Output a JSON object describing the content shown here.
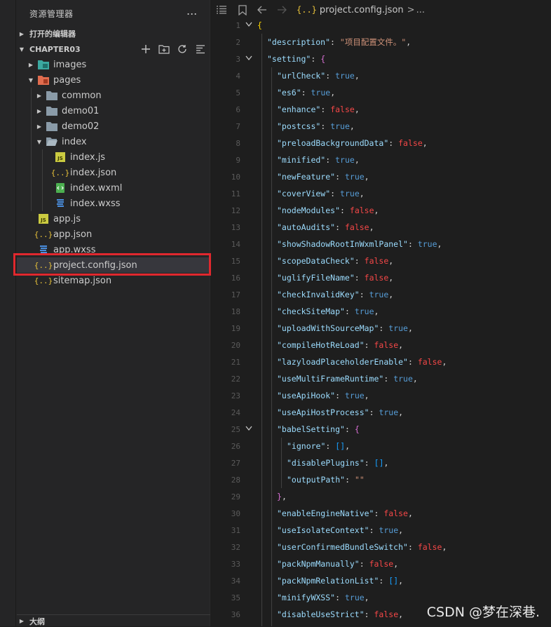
{
  "explorer": {
    "title": "资源管理器",
    "more": "...",
    "open_editors": "打开的编辑器",
    "project": "CHAPTER03",
    "outline": "大纲"
  },
  "tree": [
    {
      "label": "images",
      "depth": 1,
      "type": "folder",
      "expanded": false,
      "icon": "images-folder-icon"
    },
    {
      "label": "pages",
      "depth": 1,
      "type": "folder",
      "expanded": true,
      "icon": "pages-folder-icon"
    },
    {
      "label": "common",
      "depth": 2,
      "type": "folder",
      "expanded": false,
      "icon": "folder-icon"
    },
    {
      "label": "demo01",
      "depth": 2,
      "type": "folder",
      "expanded": false,
      "icon": "folder-icon"
    },
    {
      "label": "demo02",
      "depth": 2,
      "type": "folder",
      "expanded": false,
      "icon": "folder-icon"
    },
    {
      "label": "index",
      "depth": 2,
      "type": "folder",
      "expanded": true,
      "icon": "folder-open-icon"
    },
    {
      "label": "index.js",
      "depth": 3,
      "type": "js",
      "icon": "js-file-icon"
    },
    {
      "label": "index.json",
      "depth": 3,
      "type": "json",
      "icon": "json-file-icon"
    },
    {
      "label": "index.wxml",
      "depth": 3,
      "type": "wxml",
      "icon": "wxml-file-icon"
    },
    {
      "label": "index.wxss",
      "depth": 3,
      "type": "wxss",
      "icon": "wxss-file-icon"
    },
    {
      "label": "app.js",
      "depth": 1,
      "type": "js",
      "icon": "js-file-icon"
    },
    {
      "label": "app.json",
      "depth": 1,
      "type": "json",
      "icon": "json-file-icon"
    },
    {
      "label": "app.wxss",
      "depth": 1,
      "type": "wxss",
      "icon": "wxss-file-icon"
    },
    {
      "label": "project.config.json",
      "depth": 1,
      "type": "json",
      "icon": "json-file-icon",
      "selected": true
    },
    {
      "label": "sitemap.json",
      "depth": 1,
      "type": "json",
      "icon": "json-file-icon"
    }
  ],
  "breadcrumb": {
    "file": "project.config.json",
    "separator": ">",
    "more": "..."
  },
  "code_lines": [
    {
      "n": "1",
      "fold": "v",
      "t": "{"
    },
    {
      "n": "2",
      "t": "\"description\": \"项目配置文件。\","
    },
    {
      "n": "3",
      "fold": "v",
      "t": "\"setting\": {"
    },
    {
      "n": "4",
      "t": "\"urlCheck\": true,"
    },
    {
      "n": "5",
      "t": "\"es6\": true,"
    },
    {
      "n": "6",
      "t": "\"enhance\": false,"
    },
    {
      "n": "7",
      "t": "\"postcss\": true,"
    },
    {
      "n": "8",
      "t": "\"preloadBackgroundData\": false,"
    },
    {
      "n": "9",
      "t": "\"minified\": true,"
    },
    {
      "n": "10",
      "t": "\"newFeature\": true,"
    },
    {
      "n": "11",
      "t": "\"coverView\": true,"
    },
    {
      "n": "12",
      "t": "\"nodeModules\": false,"
    },
    {
      "n": "13",
      "t": "\"autoAudits\": false,"
    },
    {
      "n": "14",
      "t": "\"showShadowRootInWxmlPanel\": true,"
    },
    {
      "n": "15",
      "t": "\"scopeDataCheck\": false,"
    },
    {
      "n": "16",
      "t": "\"uglifyFileName\": false,"
    },
    {
      "n": "17",
      "t": "\"checkInvalidKey\": true,"
    },
    {
      "n": "18",
      "t": "\"checkSiteMap\": true,"
    },
    {
      "n": "19",
      "t": "\"uploadWithSourceMap\": true,"
    },
    {
      "n": "20",
      "t": "\"compileHotReLoad\": false,"
    },
    {
      "n": "21",
      "t": "\"lazyloadPlaceholderEnable\": false,"
    },
    {
      "n": "22",
      "t": "\"useMultiFrameRuntime\": true,"
    },
    {
      "n": "23",
      "t": "\"useApiHook\": true,"
    },
    {
      "n": "24",
      "t": "\"useApiHostProcess\": true,"
    },
    {
      "n": "25",
      "fold": "v",
      "t": "\"babelSetting\": {"
    },
    {
      "n": "26",
      "t": "\"ignore\": [],"
    },
    {
      "n": "27",
      "t": "\"disablePlugins\": [],"
    },
    {
      "n": "28",
      "t": "\"outputPath\": \"\""
    },
    {
      "n": "29",
      "t": "},"
    },
    {
      "n": "30",
      "t": "\"enableEngineNative\": false,"
    },
    {
      "n": "31",
      "t": "\"useIsolateContext\": true,"
    },
    {
      "n": "32",
      "t": "\"userConfirmedBundleSwitch\": false,"
    },
    {
      "n": "33",
      "t": "\"packNpmManually\": false,"
    },
    {
      "n": "34",
      "t": "\"packNpmRelationList\": [],"
    },
    {
      "n": "35",
      "t": "\"minifyWXSS\": true,"
    },
    {
      "n": "36",
      "t": "\"disableUseStrict\": false,"
    }
  ],
  "watermark": "CSDN @梦在深巷.",
  "colors": {
    "key": "#9cdcfe",
    "string": "#ce9178",
    "true": "#569cd6",
    "false": "#f44747",
    "highlight": "#e0282e"
  }
}
